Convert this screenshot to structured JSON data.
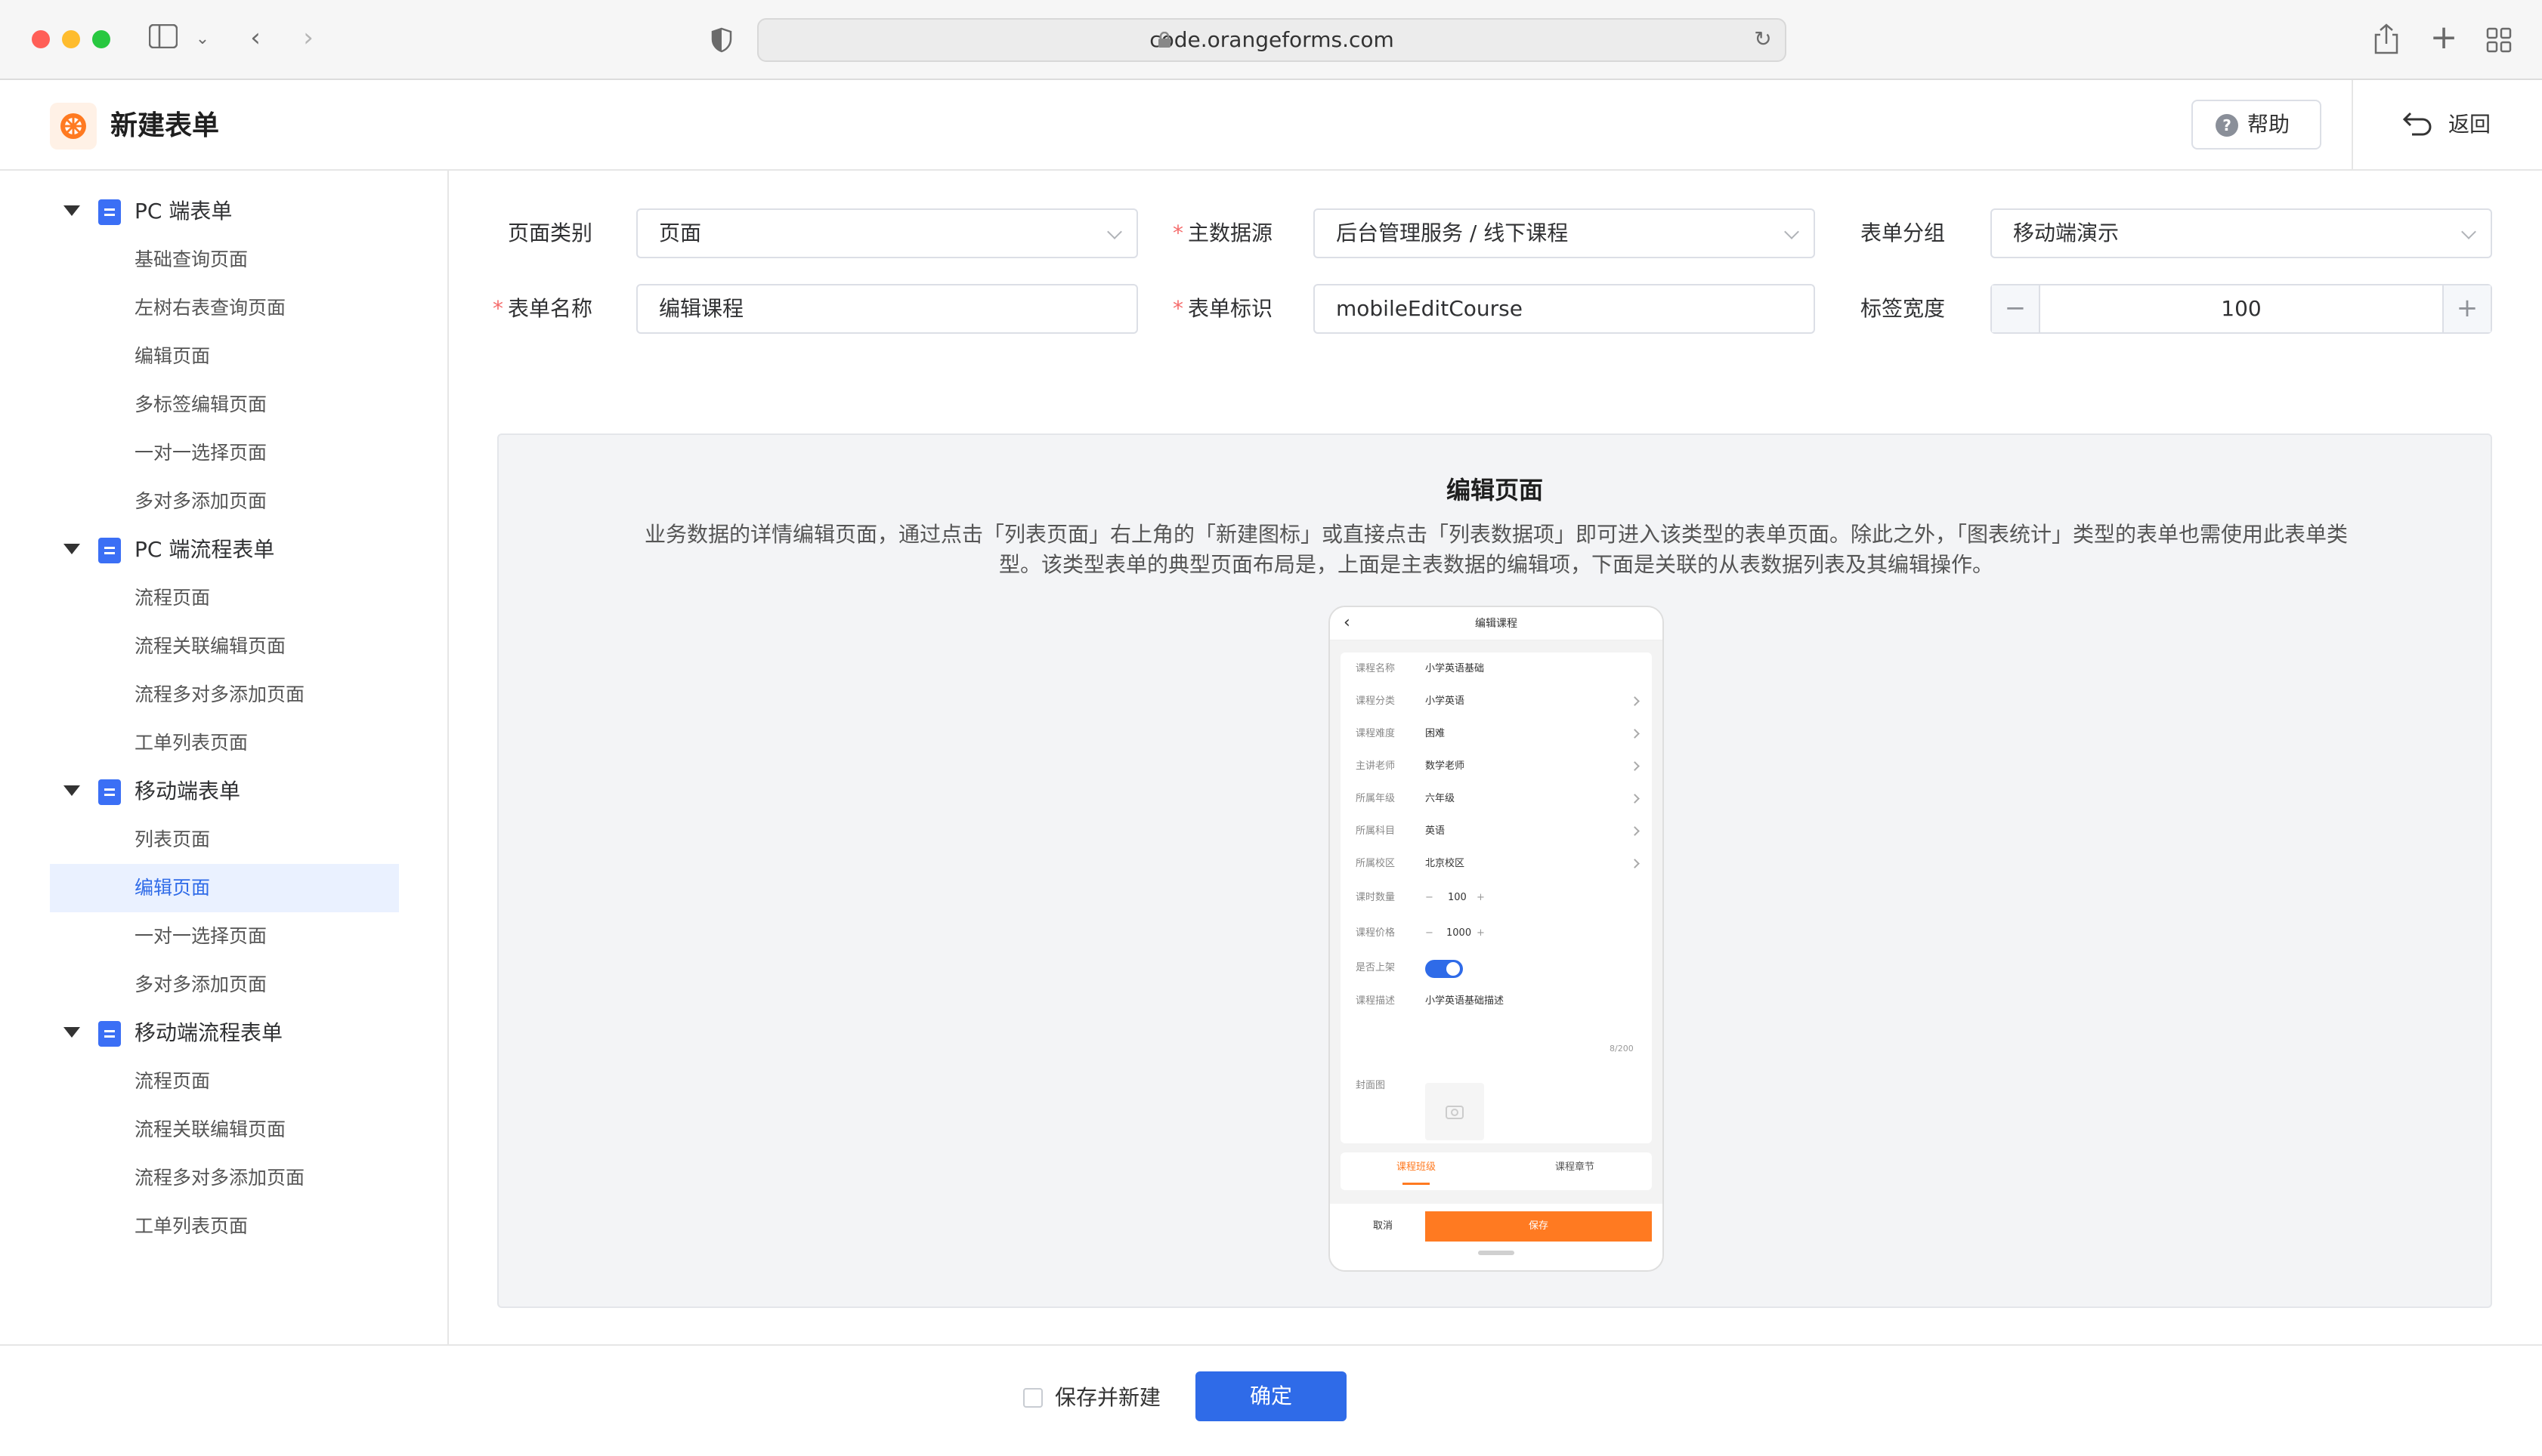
{
  "browser": {
    "url": "code.orangeforms.com",
    "traffic_lights": [
      "#ff5f57",
      "#febc2e",
      "#28c840"
    ]
  },
  "header": {
    "title": "新建表单",
    "help_label": "帮助",
    "back_label": "返回"
  },
  "sidebar": {
    "groups": [
      {
        "label": "PC 端表单",
        "items": [
          "基础查询页面",
          "左树右表查询页面",
          "编辑页面",
          "多标签编辑页面",
          "一对一选择页面",
          "多对多添加页面"
        ]
      },
      {
        "label": "PC 端流程表单",
        "items": [
          "流程页面",
          "流程关联编辑页面",
          "流程多对多添加页面",
          "工单列表页面"
        ]
      },
      {
        "label": "移动端表单",
        "items": [
          "列表页面",
          "编辑页面",
          "一对一选择页面",
          "多对多添加页面"
        ]
      },
      {
        "label": "移动端流程表单",
        "items": [
          "流程页面",
          "流程关联编辑页面",
          "流程多对多添加页面",
          "工单列表页面"
        ]
      }
    ],
    "active_item": "编辑页面",
    "active_color": "#2f6be8"
  },
  "form": {
    "page_type": {
      "label": "页面类别",
      "value": "页面"
    },
    "datasource": {
      "label": "主数据源",
      "value": "后台管理服务 / 线下课程",
      "required_mark": "*"
    },
    "group": {
      "label": "表单分组",
      "value": "移动端演示"
    },
    "form_name": {
      "label": "表单名称",
      "value": "编辑课程",
      "required_mark": "*"
    },
    "form_code": {
      "label": "表单标识",
      "value": "mobileEditCourse",
      "required_mark": "*"
    },
    "label_width": {
      "label": "标签宽度",
      "value": "100",
      "minus": "−",
      "plus": "+"
    }
  },
  "preview": {
    "title": "编辑页面",
    "description": "业务数据的详情编辑页面，通过点击「列表页面」右上角的「新建图标」或直接点击「列表数据项」即可进入该类型的表单页面。除此之外，「图表统计」类型的表单也需使用此表单类型。该类型表单的典型页面布局是，上面是主表数据的编辑项，下面是关联的从表数据列表及其编辑操作。",
    "phone": {
      "nav_title": "编辑课程",
      "rows": [
        {
          "label": "课程名称",
          "value": "小学英语基础",
          "arrow": false
        },
        {
          "label": "课程分类",
          "value": "小学英语",
          "arrow": true
        },
        {
          "label": "课程难度",
          "value": "困难",
          "arrow": true
        },
        {
          "label": "主讲老师",
          "value": "数学老师",
          "arrow": true
        },
        {
          "label": "所属年级",
          "value": "六年级",
          "arrow": true
        },
        {
          "label": "所属科目",
          "value": "英语",
          "arrow": true
        },
        {
          "label": "所属校区",
          "value": "北京校区",
          "arrow": true
        }
      ],
      "hours": {
        "label": "课时数量",
        "value": "100"
      },
      "price": {
        "label": "课程价格",
        "value": "1000"
      },
      "onshelf": {
        "label": "是否上架"
      },
      "desc": {
        "label": "课程描述",
        "value": "小学英语基础描述",
        "counter": "8/200"
      },
      "cover": {
        "label": "封面图"
      },
      "tabs": [
        "课程班级",
        "课程章节"
      ],
      "cancel_label": "取消",
      "save_label": "保存",
      "accent": "#ff7a21"
    }
  },
  "footer": {
    "save_new_label": "保存并新建",
    "confirm_label": "确定",
    "primary_color": "#2f6be8"
  }
}
